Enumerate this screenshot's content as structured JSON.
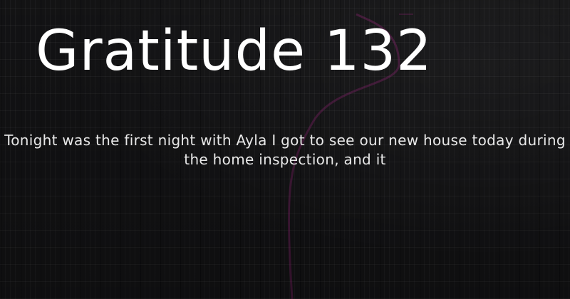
{
  "card": {
    "title": "Gratitude 132",
    "excerpt": "Tonight was the first night with Ayla I got to see our new house today during the home inspection, and it"
  },
  "colors": {
    "background": "#1a1a1c",
    "text": "#ffffff",
    "accent_glow": "#b0248c"
  }
}
